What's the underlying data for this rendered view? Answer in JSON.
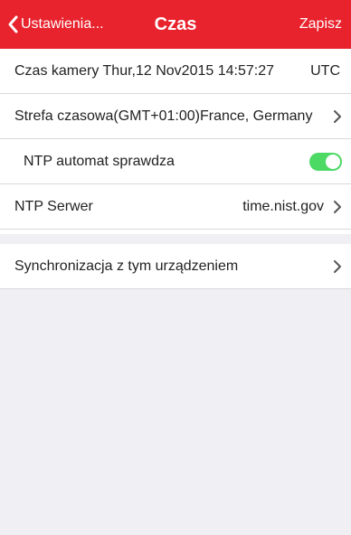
{
  "navbar": {
    "back_label": "Ustawienia...",
    "title": "Czas",
    "save_label": "Zapisz",
    "background_color": "#e8232d"
  },
  "settings": {
    "camera_time": {
      "label": "Czas kamery",
      "value": "Thur,12 Nov2015 14:57:27",
      "suffix": "UTC"
    },
    "timezone": {
      "label": "Strefa czasowa(GMT+01:00)France, Germany"
    },
    "ntp_auto": {
      "label": "NTP automat sprawdza",
      "enabled": true
    },
    "ntp_server": {
      "label": "NTP Serwer",
      "value": "time.nist.gov"
    },
    "sync_device": {
      "label": "Synchronizacja z tym urządzeniem"
    }
  },
  "colors": {
    "toggle_on": "#4cd964",
    "page_background": "#efeff4"
  }
}
